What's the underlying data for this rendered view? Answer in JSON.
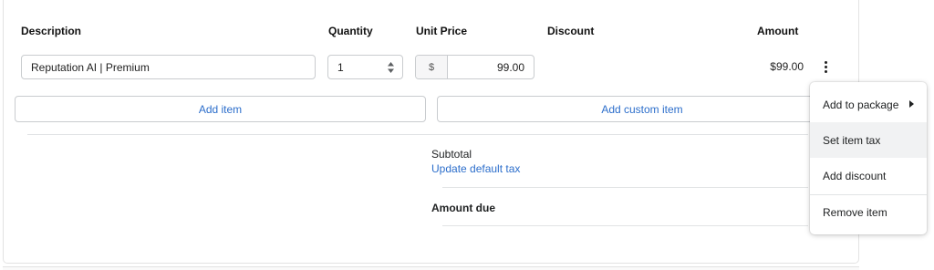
{
  "table": {
    "headers": {
      "description": "Description",
      "quantity": "Quantity",
      "unit_price": "Unit Price",
      "discount": "Discount",
      "amount": "Amount"
    },
    "rows": [
      {
        "description": "Reputation AI | Premium",
        "quantity": "1",
        "currency_symbol": "$",
        "unit_price": "99.00",
        "amount": "$99.00"
      }
    ]
  },
  "actions": {
    "add_item": "Add item",
    "add_custom_item": "Add custom item"
  },
  "summary": {
    "subtotal_label": "Subtotal",
    "update_tax_link": "Update default tax",
    "amount_due_label": "Amount due"
  },
  "context_menu": {
    "items": [
      {
        "label": "Add to package",
        "has_submenu": true
      },
      {
        "label": "Set item tax",
        "hovered": true
      },
      {
        "label": "Add discount"
      },
      {
        "label": "Remove item"
      }
    ]
  },
  "colors": {
    "link": "#2c6ecb",
    "border": "#c9cccf",
    "divider": "#e1e3e5",
    "menu_hover": "#f1f2f3"
  },
  "icons": {
    "row_menu": "more-vertical-icon",
    "quantity_spinner": "stepper-arrows-icon",
    "submenu": "caret-right-icon"
  }
}
